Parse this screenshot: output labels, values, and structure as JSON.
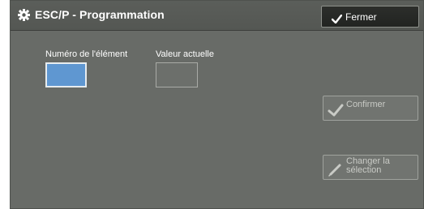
{
  "window": {
    "title": "ESC/P - Programmation",
    "title_icon": "gear-icon",
    "close_label": "Fermer",
    "close_icon": "checkmark-icon"
  },
  "fields": {
    "item_number_label": "Numéro de l'élément",
    "item_number_value": "",
    "current_value_label": "Valeur actuelle",
    "current_value": ""
  },
  "actions": {
    "confirm_label": "Confirmer",
    "confirm_icon": "checkmark-icon",
    "change_label_line1": "Changer la",
    "change_label_line2": "sélection",
    "change_icon": "pencil-icon"
  },
  "colors": {
    "panel": "#686b67",
    "titlebar": "#575a56",
    "close_button": "#262825",
    "selected_field": "#5f97d1",
    "disabled_text": "#c9cbc6"
  }
}
